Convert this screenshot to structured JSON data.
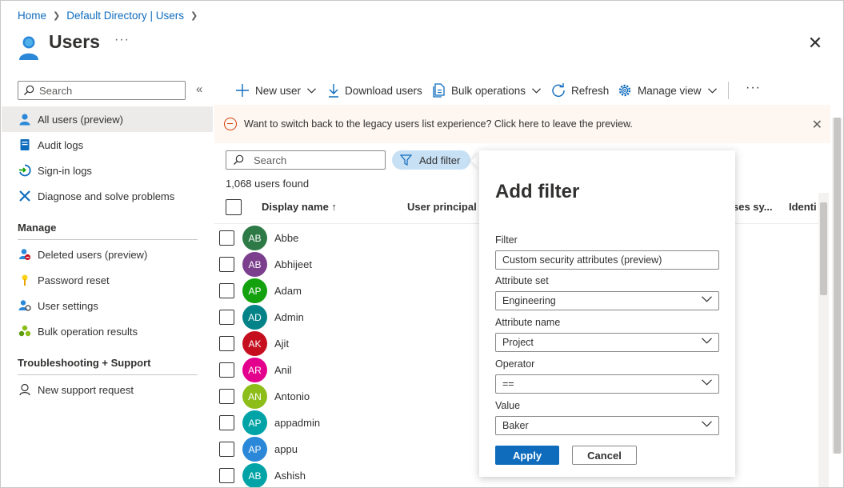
{
  "breadcrumb": {
    "home": "Home",
    "directory": "Default Directory | Users"
  },
  "header": {
    "title": "Users",
    "more": "···"
  },
  "sidebar": {
    "search_placeholder": "Search",
    "collapse": "«",
    "items": [
      {
        "label": "All users (preview)"
      },
      {
        "label": "Audit logs"
      },
      {
        "label": "Sign-in logs"
      },
      {
        "label": "Diagnose and solve problems"
      }
    ],
    "manage_heading": "Manage",
    "manage_items": [
      {
        "label": "Deleted users (preview)"
      },
      {
        "label": "Password reset"
      },
      {
        "label": "User settings"
      },
      {
        "label": "Bulk operation results"
      }
    ],
    "support_heading": "Troubleshooting + Support",
    "support_items": [
      {
        "label": "New support request"
      }
    ]
  },
  "toolbar": {
    "new_user": "New user",
    "download_users": "Download users",
    "bulk_operations": "Bulk operations",
    "refresh": "Refresh",
    "manage_view": "Manage view",
    "more": "···"
  },
  "banner": {
    "text": "Want to switch back to the legacy users list experience? Click here to leave the preview."
  },
  "list": {
    "search_placeholder": "Search",
    "add_filter": "Add filter",
    "count": "1,068 users found",
    "columns": {
      "display_name": "Display name ↑",
      "upn": "User principal n",
      "on_prem": "ses sy...",
      "identities": "Identi"
    },
    "rows": [
      {
        "initials": "AB",
        "name": "Abbe",
        "color": "#2e7a46"
      },
      {
        "initials": "AB",
        "name": "Abhijeet",
        "color": "#7b3f8e"
      },
      {
        "initials": "AP",
        "name": "Adam",
        "color": "#13a10e"
      },
      {
        "initials": "AD",
        "name": "Admin",
        "color": "#038387"
      },
      {
        "initials": "AK",
        "name": "Ajit",
        "color": "#c50f1f"
      },
      {
        "initials": "AR",
        "name": "Anil",
        "color": "#e3008c"
      },
      {
        "initials": "AN",
        "name": "Antonio",
        "color": "#8cbd18"
      },
      {
        "initials": "AP",
        "name": "appadmin",
        "color": "#00a4a6"
      },
      {
        "initials": "AP",
        "name": "appu",
        "color": "#2b88d8"
      },
      {
        "initials": "AB",
        "name": "Ashish",
        "color": "#00a4a6"
      }
    ]
  },
  "filter_panel": {
    "title": "Add filter",
    "filter_label": "Filter",
    "filter_value": "Custom security attributes (preview)",
    "attr_set_label": "Attribute set",
    "attr_set_value": "Engineering",
    "attr_name_label": "Attribute name",
    "attr_name_value": "Project",
    "operator_label": "Operator",
    "operator_value": "==",
    "value_label": "Value",
    "value_value": "Baker",
    "apply": "Apply",
    "cancel": "Cancel"
  },
  "colors": {
    "accent": "#0f6cbd",
    "banner_bg": "#fdf6f1",
    "active_nav": "#edebe9",
    "filter_pill": "#c7e0f4"
  }
}
